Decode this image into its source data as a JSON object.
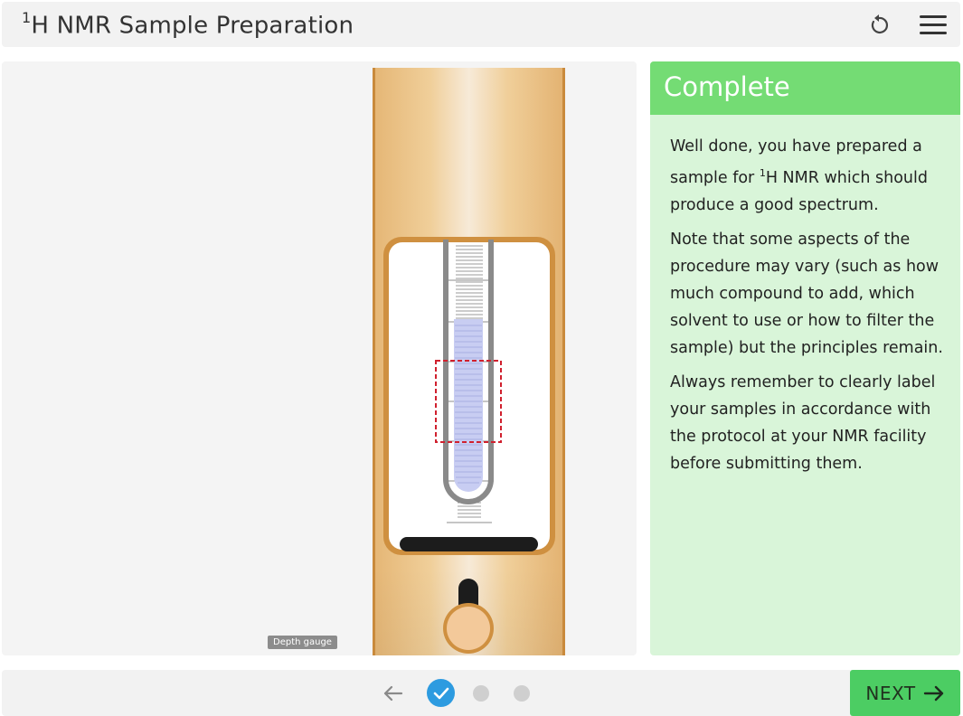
{
  "header": {
    "title_sup": "1",
    "title_text": "H NMR Sample Preparation",
    "reset_icon": "reset-icon",
    "menu_icon": "hamburger-menu-icon"
  },
  "simulation": {
    "depth_gauge_label": "Depth gauge"
  },
  "panel": {
    "heading": "Complete",
    "p1_before": "Well done, you have prepared a sample for ",
    "p1_sup": "1",
    "p1_after": "H NMR which should produce a good spectrum.",
    "p2": "Note that some aspects of the procedure may vary (such as how much compound to add, which solvent to use or how to filter the sample) but the principles remain.",
    "p3": "Always remember to clearly label your samples in accordance with the protocol at your NMR facility before submitting them."
  },
  "footer": {
    "back_icon": "arrow-left-icon",
    "step_check_icon": "check-icon",
    "next_label": "NEXT",
    "next_icon": "arrow-right-icon"
  },
  "colors": {
    "header_bg": "#f2f2f2",
    "panel_bg": "#d9f5d9",
    "panel_header": "#74dc74",
    "next_button": "#4ccd63",
    "active_step": "#2d9be0",
    "gauge_wood": "#e8bc7c",
    "solution": "#c8cdf2",
    "guide_box": "#d0202e"
  }
}
